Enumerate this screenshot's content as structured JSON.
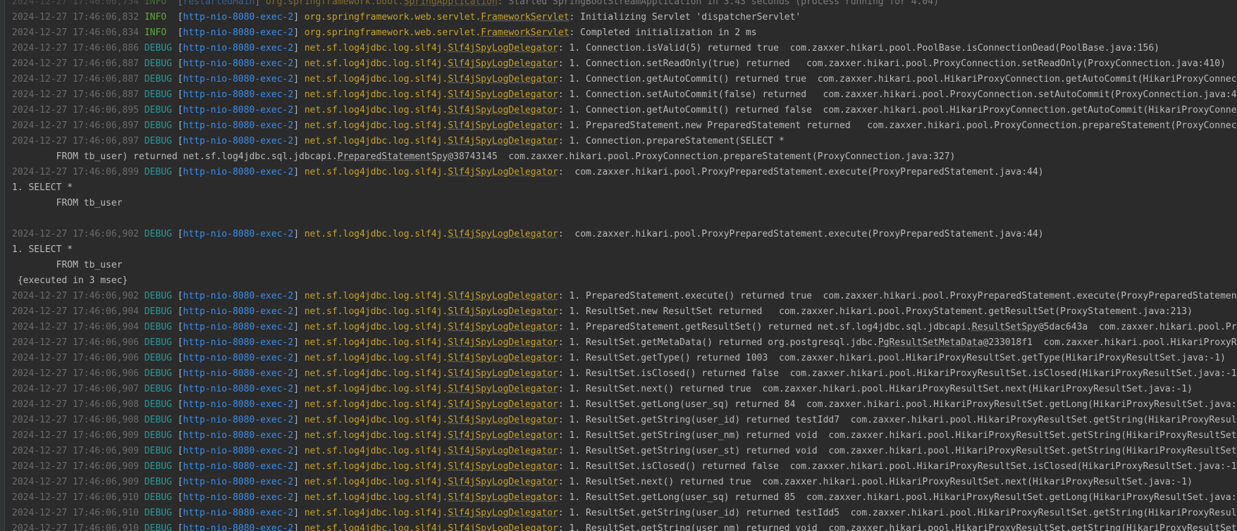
{
  "lines": [
    {
      "type": "log",
      "faded": true,
      "ts": "2024-12-27 17:46:06,754",
      "level": "INFO",
      "thread": "restartedMain",
      "logger_pkg": "org.springframework.boot.",
      "logger_cls": "SpringApplication",
      "msg": ": Started SpringBootStreamApplication in 3.43 seconds (process running for 4.04)"
    },
    {
      "type": "log",
      "ts": "2024-12-27 17:46:06,832",
      "level": "INFO",
      "thread": "http-nio-8080-exec-2",
      "logger_pkg": "org.springframework.web.servlet.",
      "logger_cls": "FrameworkServlet",
      "msg": ": Initializing Servlet 'dispatcherServlet'"
    },
    {
      "type": "log",
      "ts": "2024-12-27 17:46:06,834",
      "level": "INFO",
      "thread": "http-nio-8080-exec-2",
      "logger_pkg": "org.springframework.web.servlet.",
      "logger_cls": "FrameworkServlet",
      "msg": ": Completed initialization in 2 ms"
    },
    {
      "type": "log",
      "ts": "2024-12-27 17:46:06,886",
      "level": "DEBUG",
      "thread": "http-nio-8080-exec-2",
      "logger_pkg": "net.sf.log4jdbc.log.slf4j.",
      "logger_cls": "Slf4jSpyLogDelegator",
      "msg": ": 1. Connection.isValid(5) returned true  com.zaxxer.hikari.pool.PoolBase.isConnectionDead(PoolBase.java:156)"
    },
    {
      "type": "log",
      "ts": "2024-12-27 17:46:06,887",
      "level": "DEBUG",
      "thread": "http-nio-8080-exec-2",
      "logger_pkg": "net.sf.log4jdbc.log.slf4j.",
      "logger_cls": "Slf4jSpyLogDelegator",
      "msg": ": 1. Connection.setReadOnly(true) returned   com.zaxxer.hikari.pool.ProxyConnection.setReadOnly(ProxyConnection.java:410)"
    },
    {
      "type": "log",
      "ts": "2024-12-27 17:46:06,887",
      "level": "DEBUG",
      "thread": "http-nio-8080-exec-2",
      "logger_pkg": "net.sf.log4jdbc.log.slf4j.",
      "logger_cls": "Slf4jSpyLogDelegator",
      "msg": ": 1. Connection.getAutoCommit() returned true  com.zaxxer.hikari.pool.HikariProxyConnection.getAutoCommit(HikariProxyConnect"
    },
    {
      "type": "log",
      "ts": "2024-12-27 17:46:06,887",
      "level": "DEBUG",
      "thread": "http-nio-8080-exec-2",
      "logger_pkg": "net.sf.log4jdbc.log.slf4j.",
      "logger_cls": "Slf4jSpyLogDelegator",
      "msg": ": 1. Connection.setAutoCommit(false) returned   com.zaxxer.hikari.pool.ProxyConnection.setAutoCommit(ProxyConnection.java:40"
    },
    {
      "type": "log",
      "ts": "2024-12-27 17:46:06,895",
      "level": "DEBUG",
      "thread": "http-nio-8080-exec-2",
      "logger_pkg": "net.sf.log4jdbc.log.slf4j.",
      "logger_cls": "Slf4jSpyLogDelegator",
      "msg": ": 1. Connection.getAutoCommit() returned false  com.zaxxer.hikari.pool.HikariProxyConnection.getAutoCommit(HikariProxyConnec"
    },
    {
      "type": "log",
      "ts": "2024-12-27 17:46:06,897",
      "level": "DEBUG",
      "thread": "http-nio-8080-exec-2",
      "logger_pkg": "net.sf.log4jdbc.log.slf4j.",
      "logger_cls": "Slf4jSpyLogDelegator",
      "msg": ": 1. PreparedStatement.new PreparedStatement returned   com.zaxxer.hikari.pool.ProxyConnection.prepareStatement(ProxyConnect"
    },
    {
      "type": "log",
      "ts": "2024-12-27 17:46:06,897",
      "level": "DEBUG",
      "thread": "http-nio-8080-exec-2",
      "logger_pkg": "net.sf.log4jdbc.log.slf4j.",
      "logger_cls": "Slf4jSpyLogDelegator",
      "msg": ": 1. Connection.prepareStatement(SELECT *"
    },
    {
      "type": "split",
      "pre": "        FROM tb_user) returned net.sf.log4jdbc.sql.jdbcapi.",
      "ul": "PreparedStatementSpy",
      "post": "@38743145  com.zaxxer.hikari.pool.ProxyConnection.prepareStatement(ProxyConnection.java:327)"
    },
    {
      "type": "log",
      "ts": "2024-12-27 17:46:06,899",
      "level": "DEBUG",
      "thread": "http-nio-8080-exec-2",
      "logger_pkg": "net.sf.log4jdbc.log.slf4j.",
      "logger_cls": "Slf4jSpyLogDelegator",
      "msg": ":  com.zaxxer.hikari.pool.ProxyPreparedStatement.execute(ProxyPreparedStatement.java:44)"
    },
    {
      "type": "plain",
      "text": "1. SELECT *"
    },
    {
      "type": "plain",
      "text": "        FROM tb_user"
    },
    {
      "type": "plain",
      "text": ""
    },
    {
      "type": "log",
      "ts": "2024-12-27 17:46:06,902",
      "level": "DEBUG",
      "thread": "http-nio-8080-exec-2",
      "logger_pkg": "net.sf.log4jdbc.log.slf4j.",
      "logger_cls": "Slf4jSpyLogDelegator",
      "msg": ":  com.zaxxer.hikari.pool.ProxyPreparedStatement.execute(ProxyPreparedStatement.java:44)"
    },
    {
      "type": "plain",
      "text": "1. SELECT *"
    },
    {
      "type": "plain",
      "text": "        FROM tb_user"
    },
    {
      "type": "plain",
      "text": " {executed in 3 msec}"
    },
    {
      "type": "log",
      "ts": "2024-12-27 17:46:06,902",
      "level": "DEBUG",
      "thread": "http-nio-8080-exec-2",
      "logger_pkg": "net.sf.log4jdbc.log.slf4j.",
      "logger_cls": "Slf4jSpyLogDelegator",
      "msg": ": 1. PreparedStatement.execute() returned true  com.zaxxer.hikari.pool.ProxyPreparedStatement.execute(ProxyPreparedStatement"
    },
    {
      "type": "log",
      "ts": "2024-12-27 17:46:06,904",
      "level": "DEBUG",
      "thread": "http-nio-8080-exec-2",
      "logger_pkg": "net.sf.log4jdbc.log.slf4j.",
      "logger_cls": "Slf4jSpyLogDelegator",
      "msg": ": 1. ResultSet.new ResultSet returned   com.zaxxer.hikari.pool.ProxyStatement.getResultSet(ProxyStatement.java:213)"
    },
    {
      "type": "log",
      "ts": "2024-12-27 17:46:06,904",
      "level": "DEBUG",
      "thread": "http-nio-8080-exec-2",
      "logger_pkg": "net.sf.log4jdbc.log.slf4j.",
      "logger_cls": "Slf4jSpyLogDelegator",
      "msg_pre": ": 1. PreparedStatement.getResultSet() returned net.sf.log4jdbc.sql.jdbcapi.",
      "msg_ul": "ResultSetSpy",
      "msg_post": "@5dac643a  com.zaxxer.hikari.pool.Pro"
    },
    {
      "type": "log",
      "ts": "2024-12-27 17:46:06,906",
      "level": "DEBUG",
      "thread": "http-nio-8080-exec-2",
      "logger_pkg": "net.sf.log4jdbc.log.slf4j.",
      "logger_cls": "Slf4jSpyLogDelegator",
      "msg_pre": ": 1. ResultSet.getMetaData() returned org.postgresql.jdbc.",
      "msg_ul": "PgResultSetMetaData",
      "msg_post": "@233018f1  com.zaxxer.hikari.pool.HikariProxyRes"
    },
    {
      "type": "log",
      "ts": "2024-12-27 17:46:06,906",
      "level": "DEBUG",
      "thread": "http-nio-8080-exec-2",
      "logger_pkg": "net.sf.log4jdbc.log.slf4j.",
      "logger_cls": "Slf4jSpyLogDelegator",
      "msg": ": 1. ResultSet.getType() returned 1003  com.zaxxer.hikari.pool.HikariProxyResultSet.getType(HikariProxyResultSet.java:-1)"
    },
    {
      "type": "log",
      "ts": "2024-12-27 17:46:06,906",
      "level": "DEBUG",
      "thread": "http-nio-8080-exec-2",
      "logger_pkg": "net.sf.log4jdbc.log.slf4j.",
      "logger_cls": "Slf4jSpyLogDelegator",
      "msg": ": 1. ResultSet.isClosed() returned false  com.zaxxer.hikari.pool.HikariProxyResultSet.isClosed(HikariProxyResultSet.java:-1)"
    },
    {
      "type": "log",
      "ts": "2024-12-27 17:46:06,907",
      "level": "DEBUG",
      "thread": "http-nio-8080-exec-2",
      "logger_pkg": "net.sf.log4jdbc.log.slf4j.",
      "logger_cls": "Slf4jSpyLogDelegator",
      "msg": ": 1. ResultSet.next() returned true  com.zaxxer.hikari.pool.HikariProxyResultSet.next(HikariProxyResultSet.java:-1)"
    },
    {
      "type": "log",
      "ts": "2024-12-27 17:46:06,908",
      "level": "DEBUG",
      "thread": "http-nio-8080-exec-2",
      "logger_pkg": "net.sf.log4jdbc.log.slf4j.",
      "logger_cls": "Slf4jSpyLogDelegator",
      "msg": ": 1. ResultSet.getLong(user_sq) returned 84  com.zaxxer.hikari.pool.HikariProxyResultSet.getLong(HikariProxyResultSet.java:-"
    },
    {
      "type": "log",
      "ts": "2024-12-27 17:46:06,908",
      "level": "DEBUG",
      "thread": "http-nio-8080-exec-2",
      "logger_pkg": "net.sf.log4jdbc.log.slf4j.",
      "logger_cls": "Slf4jSpyLogDelegator",
      "msg": ": 1. ResultSet.getString(user_id) returned testIdd7  com.zaxxer.hikari.pool.HikariProxyResultSet.getString(HikariProxyResult"
    },
    {
      "type": "log",
      "ts": "2024-12-27 17:46:06,909",
      "level": "DEBUG",
      "thread": "http-nio-8080-exec-2",
      "logger_pkg": "net.sf.log4jdbc.log.slf4j.",
      "logger_cls": "Slf4jSpyLogDelegator",
      "msg": ": 1. ResultSet.getString(user_nm) returned void  com.zaxxer.hikari.pool.HikariProxyResultSet.getString(HikariProxyResultSet."
    },
    {
      "type": "log",
      "ts": "2024-12-27 17:46:06,909",
      "level": "DEBUG",
      "thread": "http-nio-8080-exec-2",
      "logger_pkg": "net.sf.log4jdbc.log.slf4j.",
      "logger_cls": "Slf4jSpyLogDelegator",
      "msg": ": 1. ResultSet.getString(user_st) returned void  com.zaxxer.hikari.pool.HikariProxyResultSet.getString(HikariProxyResultSet."
    },
    {
      "type": "log",
      "ts": "2024-12-27 17:46:06,909",
      "level": "DEBUG",
      "thread": "http-nio-8080-exec-2",
      "logger_pkg": "net.sf.log4jdbc.log.slf4j.",
      "logger_cls": "Slf4jSpyLogDelegator",
      "msg": ": 1. ResultSet.isClosed() returned false  com.zaxxer.hikari.pool.HikariProxyResultSet.isClosed(HikariProxyResultSet.java:-1)"
    },
    {
      "type": "log",
      "ts": "2024-12-27 17:46:06,909",
      "level": "DEBUG",
      "thread": "http-nio-8080-exec-2",
      "logger_pkg": "net.sf.log4jdbc.log.slf4j.",
      "logger_cls": "Slf4jSpyLogDelegator",
      "msg": ": 1. ResultSet.next() returned true  com.zaxxer.hikari.pool.HikariProxyResultSet.next(HikariProxyResultSet.java:-1)"
    },
    {
      "type": "log",
      "ts": "2024-12-27 17:46:06,910",
      "level": "DEBUG",
      "thread": "http-nio-8080-exec-2",
      "logger_pkg": "net.sf.log4jdbc.log.slf4j.",
      "logger_cls": "Slf4jSpyLogDelegator",
      "msg": ": 1. ResultSet.getLong(user_sq) returned 85  com.zaxxer.hikari.pool.HikariProxyResultSet.getLong(HikariProxyResultSet.java:-"
    },
    {
      "type": "log",
      "ts": "2024-12-27 17:46:06,910",
      "level": "DEBUG",
      "thread": "http-nio-8080-exec-2",
      "logger_pkg": "net.sf.log4jdbc.log.slf4j.",
      "logger_cls": "Slf4jSpyLogDelegator",
      "msg": ": 1. ResultSet.getString(user_id) returned testIdd5  com.zaxxer.hikari.pool.HikariProxyResultSet.getString(HikariProxyResult"
    },
    {
      "type": "log",
      "ts": "2024-12-27 17:46:06,910",
      "level": "DEBUG",
      "thread": "http-nio-8080-exec-2",
      "logger_pkg": "net.sf.log4jdbc.log.slf4j.",
      "logger_cls": "Slf4jSpyLogDelegator",
      "msg": ": 1. ResultSet.getString(user_nm) returned void  com.zaxxer.hikari.pool.HikariProxyResultSet.getString(HikariProxyResultSet."
    }
  ]
}
